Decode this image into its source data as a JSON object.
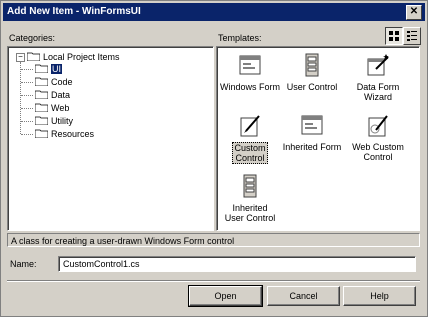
{
  "window": {
    "title": "Add New Item - WinFormsUI",
    "close_glyph": "✕"
  },
  "categories": {
    "label": "Categories:",
    "root": "Local Project Items",
    "expander": "−",
    "items": [
      {
        "label": "UI",
        "selected": true
      },
      {
        "label": "Code"
      },
      {
        "label": "Data"
      },
      {
        "label": "Web"
      },
      {
        "label": "Utility"
      },
      {
        "label": "Resources"
      }
    ]
  },
  "templates": {
    "label": "Templates:",
    "items": [
      {
        "label": "Windows Form",
        "icon": "windows-form-icon"
      },
      {
        "label": "User Control",
        "icon": "user-control-icon"
      },
      {
        "label": "Data Form Wizard",
        "icon": "data-form-wizard-icon"
      },
      {
        "label": "Custom Control",
        "icon": "custom-control-icon",
        "selected": true
      },
      {
        "label": "Inherited Form",
        "icon": "inherited-form-icon"
      },
      {
        "label": "Web Custom Control",
        "icon": "web-custom-control-icon"
      },
      {
        "label": "Inherited User Control",
        "icon": "inherited-user-control-icon"
      }
    ],
    "view_buttons": [
      "large-icons-view",
      "small-icons-view"
    ]
  },
  "description": "A class for creating a user-drawn Windows Form control",
  "name_field": {
    "label": "Name:",
    "value": "CustomControl1.cs"
  },
  "buttons": {
    "open": "Open",
    "cancel": "Cancel",
    "help": "Help"
  },
  "colors": {
    "titlebar": "#0a246a",
    "face": "#d4d0c8",
    "selection": "#0a246a"
  }
}
